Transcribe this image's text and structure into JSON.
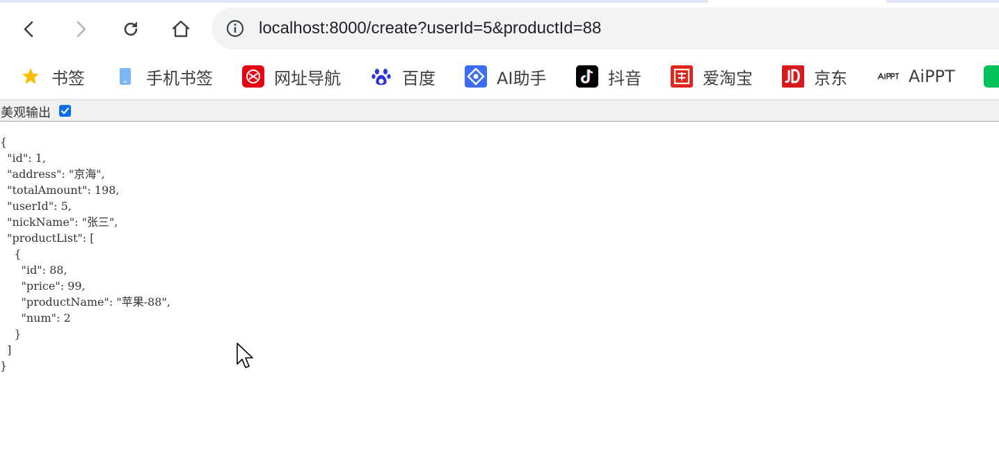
{
  "browser": {
    "address_bar": {
      "url": "localhost:8000/create?userId=5&productId=88",
      "site_info_icon": "info-icon"
    },
    "nav_icons": [
      "back-arrow-icon",
      "forward-arrow-icon",
      "reload-icon",
      "home-icon"
    ],
    "bookmarks": [
      {
        "label": "书签",
        "icon": "star-icon",
        "color": "#fbbc04"
      },
      {
        "label": "手机书签",
        "icon": "phone-icon",
        "color": "#7cb7f5"
      },
      {
        "label": "网址导航",
        "icon": "navigation-logo-icon",
        "color": "#e60012"
      },
      {
        "label": "百度",
        "icon": "baidu-paw-icon",
        "color": "#2932e1"
      },
      {
        "label": "AI助手",
        "icon": "ai-assistant-icon",
        "color": "#3d6cf5"
      },
      {
        "label": "抖音",
        "icon": "douyin-icon",
        "color": "#000000"
      },
      {
        "label": "爱淘宝",
        "icon": "taobao-icon",
        "color": "#e0261c"
      },
      {
        "label": "京东",
        "icon": "jd-icon",
        "color": "#d71c1e"
      },
      {
        "label": "AiPPT",
        "icon": "aippt-logo-icon",
        "color": "#222222"
      }
    ]
  },
  "page": {
    "pretty_print_label": "美观输出",
    "pretty_print_checked": true,
    "json_lines": [
      "{",
      "  \"id\": 1,",
      "  \"address\": \"京海\",",
      "  \"totalAmount\": 198,",
      "  \"userId\": 5,",
      "  \"nickName\": \"张三\",",
      "  \"productList\": [",
      "    {",
      "      \"id\": 88,",
      "      \"price\": 99,",
      "      \"productName\": \"苹果-88\",",
      "      \"num\": 2",
      "    }",
      "  ]",
      "}"
    ]
  }
}
